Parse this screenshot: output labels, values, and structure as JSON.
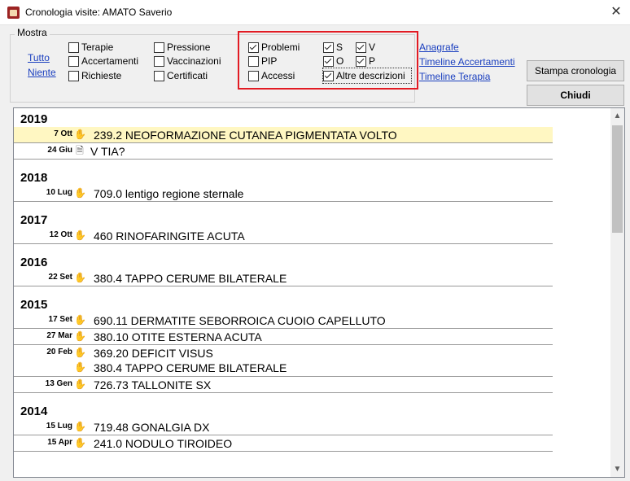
{
  "window": {
    "title": "Cronologia visite: AMATO Saverio",
    "close": "✕"
  },
  "filters": {
    "legend": "Mostra",
    "links": [
      "Tutto",
      "Niente"
    ],
    "checkboxes": [
      {
        "label": "Terapie",
        "checked": false
      },
      {
        "label": "Accertamenti",
        "checked": false
      },
      {
        "label": "Richieste",
        "checked": false
      },
      {
        "label": "Pressione",
        "checked": false
      },
      {
        "label": "Vaccinazioni",
        "checked": false
      },
      {
        "label": "Certificati",
        "checked": false
      },
      {
        "label": "Problemi",
        "checked": true
      },
      {
        "label": "PIP",
        "checked": false
      },
      {
        "label": "Accessi",
        "checked": false
      },
      {
        "label": "S",
        "checked": true
      },
      {
        "label": "O",
        "checked": true
      },
      {
        "label": "Altre descrizioni",
        "checked": true
      },
      {
        "label": "V",
        "checked": true
      },
      {
        "label": "P",
        "checked": true
      }
    ]
  },
  "nav_links": [
    "Anagrafe",
    "Timeline Accertamenti",
    "Timeline Terapia"
  ],
  "buttons": {
    "print": "Stampa cronologia",
    "close": "Chiudi"
  },
  "timeline": [
    {
      "year": "2019",
      "entries": [
        {
          "date": "7 Ott",
          "icon": "hand-icon",
          "text": "239.2 NEOFORMAZIONE CUTANEA PIGMENTATA VOLTO",
          "highlight": true
        },
        {
          "date": "24 Giu",
          "icon": "document-icon",
          "text": "V TIA?"
        }
      ]
    },
    {
      "year": "2018",
      "entries": [
        {
          "date": "10 Lug",
          "icon": "hand-icon",
          "text": "709.0 lentigo regione sternale"
        }
      ]
    },
    {
      "year": "2017",
      "entries": [
        {
          "date": "12 Ott",
          "icon": "hand-icon",
          "text": "460 RINOFARINGITE ACUTA"
        }
      ]
    },
    {
      "year": "2016",
      "entries": [
        {
          "date": "22 Set",
          "icon": "hand-icon",
          "text": "380.4 TAPPO CERUME BILATERALE"
        }
      ]
    },
    {
      "year": "2015",
      "entries": [
        {
          "date": "17 Set",
          "icon": "hand-icon",
          "text": "690.11 DERMATITE SEBORROICA CUOIO CAPELLUTO"
        },
        {
          "date": "27 Mar",
          "icon": "hand-icon",
          "text": "380.10 OTITE ESTERNA ACUTA"
        },
        {
          "date": "20 Feb",
          "icon": "hand-icon",
          "text": "369.20 DEFICIT VISUS",
          "extra": {
            "icon": "hand-icon",
            "text": "380.4 TAPPO CERUME BILATERALE"
          }
        },
        {
          "date": "13 Gen",
          "icon": "hand-icon",
          "text": "726.73 TALLONITE SX"
        }
      ]
    },
    {
      "year": "2014",
      "entries": [
        {
          "date": "15 Lug",
          "icon": "hand-icon",
          "text": "719.48 GONALGIA DX"
        },
        {
          "date": "15 Apr",
          "icon": "hand-icon",
          "text": "241.0 NODULO TIROIDEO"
        }
      ]
    }
  ]
}
